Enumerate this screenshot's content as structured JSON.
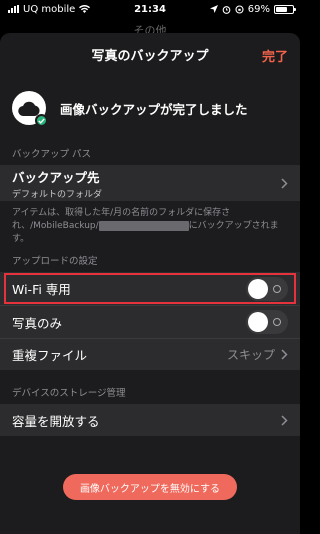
{
  "status_bar": {
    "carrier": "UQ mobile",
    "time": "21:34",
    "battery": "69%",
    "battery_level": 0.69
  },
  "background": {
    "title": "その他"
  },
  "header": {
    "title": "写真のバックアップ",
    "done_label": "完了"
  },
  "backup_status": {
    "text": "画像バックアップが完了しました"
  },
  "backup_path": {
    "section_header": "バックアップ パス",
    "destination_label": "バックアップ先",
    "destination_value": "デフォルトのフォルダ",
    "note_part1": "アイテムは、取得した年/月の名前のフォルダに保存され、/MobileBackup/",
    "note_part2": "にバックアップされます。"
  },
  "upload_settings": {
    "section_header": "アップロードの設定",
    "wifi_only_label": "Wi-Fi 専用",
    "wifi_only_on": false,
    "photos_only_label": "写真のみ",
    "photos_only_on": false,
    "duplicate_label": "重複ファイル",
    "duplicate_value": "スキップ"
  },
  "storage": {
    "section_header": "デバイスのストレージ管理",
    "free_up_label": "容量を開放する"
  },
  "footer": {
    "disable_button": "画像バックアップを無効にする"
  },
  "colors": {
    "accent": "#f2634a",
    "highlight": "#e5323d",
    "check": "#2ab27b",
    "button": "#ef6a5c"
  }
}
